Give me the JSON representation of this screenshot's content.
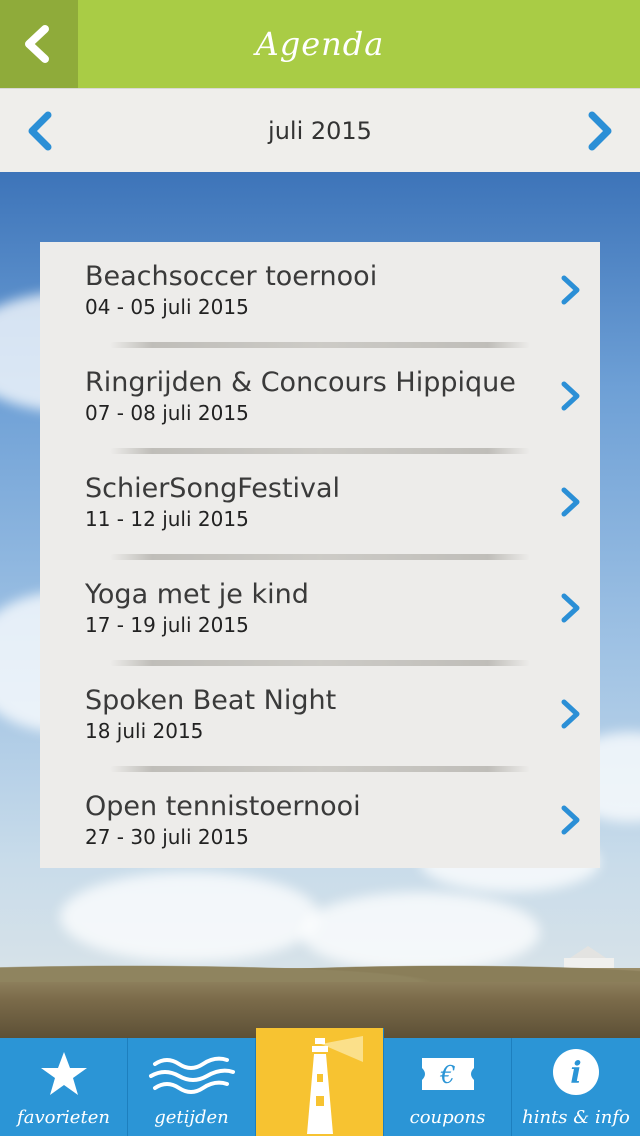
{
  "header": {
    "title": "Agenda",
    "back_icon": "back-arrow-icon"
  },
  "month": {
    "label": "juli 2015"
  },
  "events": [
    {
      "title": "Beachsoccer toernooi",
      "date": "04 - 05 juli 2015"
    },
    {
      "title": "Ringrijden & Concours Hippique",
      "date": "07 - 08 juli 2015"
    },
    {
      "title": "SchierSongFestival",
      "date": "11 - 12 juli 2015"
    },
    {
      "title": "Yoga met je kind",
      "date": "17 - 19 juli 2015"
    },
    {
      "title": "Spoken Beat Night",
      "date": "18 juli 2015"
    },
    {
      "title": "Open tennistoernooi",
      "date": "27 - 30 juli 2015"
    }
  ],
  "tabs": [
    {
      "label": "favorieten",
      "icon": "star-icon"
    },
    {
      "label": "getijden",
      "icon": "waves-icon"
    },
    {
      "label": "",
      "icon": "lighthouse-icon",
      "active": true
    },
    {
      "label": "coupons",
      "icon": "euro-ticket-icon"
    },
    {
      "label": "hints & info",
      "icon": "info-icon"
    }
  ],
  "colors": {
    "header_green": "#a9cc45",
    "back_green": "#8fab3a",
    "tab_blue": "#2b95d6",
    "tab_active_yellow": "#f7c331",
    "chevron_blue": "#2b8fd6"
  }
}
